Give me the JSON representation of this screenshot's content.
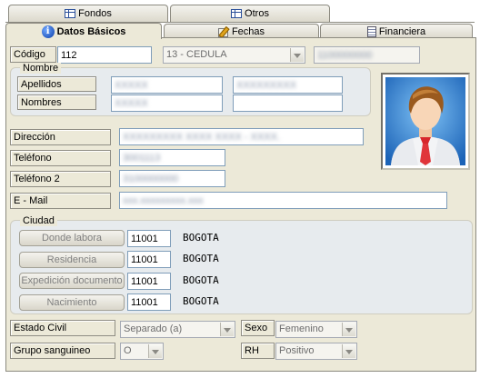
{
  "tabs_top": [
    {
      "label": "Fondos",
      "icon": "table-icon"
    },
    {
      "label": "Otros",
      "icon": "table-icon"
    }
  ],
  "tabs_main": [
    {
      "label": "Datos Básicos",
      "icon": "info-icon",
      "active": true
    },
    {
      "label": "Fechas",
      "icon": "pencil-icon"
    },
    {
      "label": "Financiera",
      "icon": "document-icon"
    }
  ],
  "codigo": {
    "label": "Código",
    "value": "112",
    "tipo_documento": "13 - CEDULA",
    "numero_documento": "1100000000"
  },
  "nombre": {
    "title": "Nombre",
    "apellidos_label": "Apellidos",
    "apellido1": "XXXXX",
    "apellido2": "XXXXXXXXX",
    "nombres_label": "Nombres",
    "nombre1": "XXXXX",
    "nombre2": ""
  },
  "direccion": {
    "label": "Dirección",
    "value": "XXXXXXXXX XXXX XXXX - XXXX."
  },
  "telefono": {
    "label": "Teléfono",
    "value": "3001113"
  },
  "telefono2": {
    "label": "Teléfono 2",
    "value": "3100000000"
  },
  "email": {
    "label": "E - Mail",
    "value": "xxx.xxxxxxxxx.xxx"
  },
  "ciudad": {
    "title": "Ciudad",
    "rows": [
      {
        "label": "Donde labora",
        "code": "11001",
        "name": "BOGOTA"
      },
      {
        "label": "Residencia",
        "code": "11001",
        "name": "BOGOTA"
      },
      {
        "label": "Expedición documento",
        "code": "11001",
        "name": "BOGOTA"
      },
      {
        "label": "Nacimiento",
        "code": "11001",
        "name": "BOGOTA"
      }
    ]
  },
  "estado_civil": {
    "label": "Estado Civil",
    "value": "Separado (a)"
  },
  "sexo": {
    "label": "Sexo",
    "value": "Femenino"
  },
  "grupo_sanguineo": {
    "label": "Grupo sanguineo",
    "value": "O"
  },
  "rh": {
    "label": "RH",
    "value": "Positivo"
  },
  "colors": {
    "panel": "#ece9d8",
    "input_border": "#7f9db9",
    "photo_bg": "#3d8ed6"
  }
}
